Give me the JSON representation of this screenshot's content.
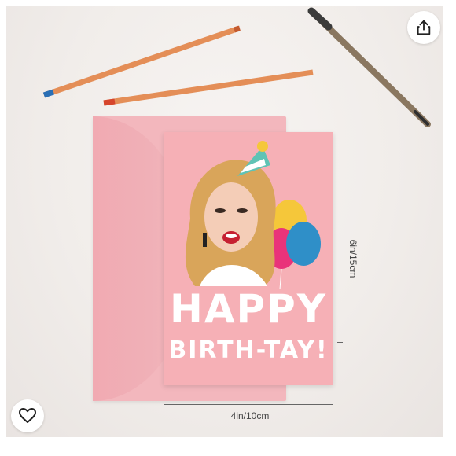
{
  "product_image": {
    "card": {
      "line1": "HAPPY",
      "line2": "BIRTH-TAY!"
    },
    "dimensions": {
      "height_label": "6in/15cm",
      "width_label": "4in/10cm"
    }
  },
  "actions": {
    "share_icon": "share-icon",
    "like_icon": "heart-icon"
  },
  "colors": {
    "card_pink": "#f6b0b6",
    "envelope_pink": "#f3b7bd",
    "background": "#f1edea"
  }
}
